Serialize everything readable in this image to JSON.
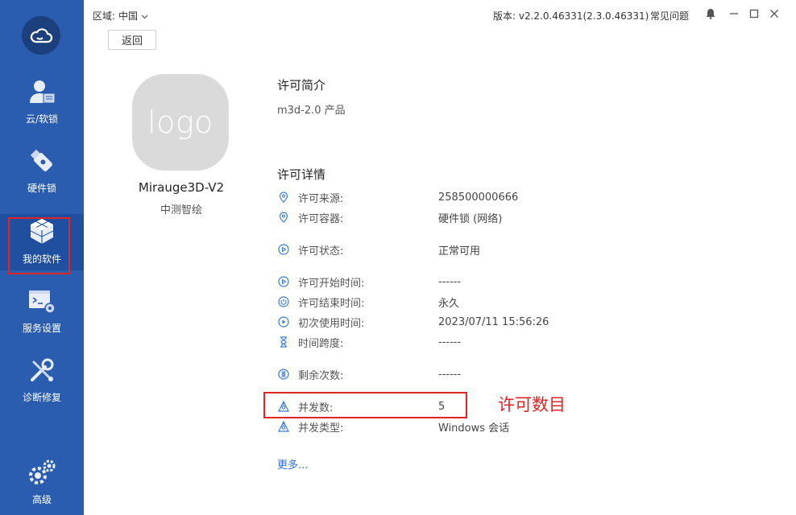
{
  "sidebar": {
    "logo_icon": "cloud-icon",
    "items": [
      {
        "label": "云/软锁",
        "icon": "user-icon"
      },
      {
        "label": "硬件锁",
        "icon": "usb-key-icon"
      },
      {
        "label": "我的软件",
        "icon": "cubes-icon",
        "active": true
      },
      {
        "label": "服务设置",
        "icon": "terminal-gear-icon"
      },
      {
        "label": "诊断修复",
        "icon": "tools-icon"
      },
      {
        "label": "高级",
        "icon": "gears-icon"
      }
    ]
  },
  "topbar": {
    "region_label": "区域:",
    "region_value": "中国",
    "version": "版本: v2.2.0.46331(2.3.0.46331)",
    "faq": "常见问题"
  },
  "back_label": "返回",
  "product": {
    "logo_text": "logo",
    "name": "Mirauge3D-V2",
    "vendor": "中测智绘"
  },
  "intro": {
    "title": "许可简介",
    "description": "m3d-2.0 产品"
  },
  "details": {
    "title": "许可详情",
    "rows": [
      {
        "label": "许可来源:",
        "value": "258500000666",
        "icon": "location-icon"
      },
      {
        "label": "许可容器:",
        "value": "硬件锁 (网络)",
        "icon": "location-icon"
      },
      {
        "label": "许可状态:",
        "value": "正常可用",
        "icon": "play-circle-icon"
      },
      {
        "label": "许可开始时间:",
        "value": "------",
        "icon": "play-circle-icon"
      },
      {
        "label": "许可结束时间:",
        "value": "永久",
        "icon": "power-icon"
      },
      {
        "label": "初次使用时间:",
        "value": "2023/07/11 15:56:26",
        "icon": "play-circle-icon"
      },
      {
        "label": "时间跨度:",
        "value": "------",
        "icon": "hourglass-icon"
      },
      {
        "label": "剩余次数:",
        "value": "------",
        "icon": "hourglass-circle-icon"
      },
      {
        "label": "并发数:",
        "value": "5",
        "icon": "network-icon"
      },
      {
        "label": "并发类型:",
        "value": "Windows 会话",
        "icon": "network-icon"
      }
    ],
    "more_link": "更多..."
  },
  "annotation": "许可数目",
  "colors": {
    "sidebar": "#2a5db0",
    "accent": "#2f6fd6",
    "highlight": "#e02424"
  }
}
